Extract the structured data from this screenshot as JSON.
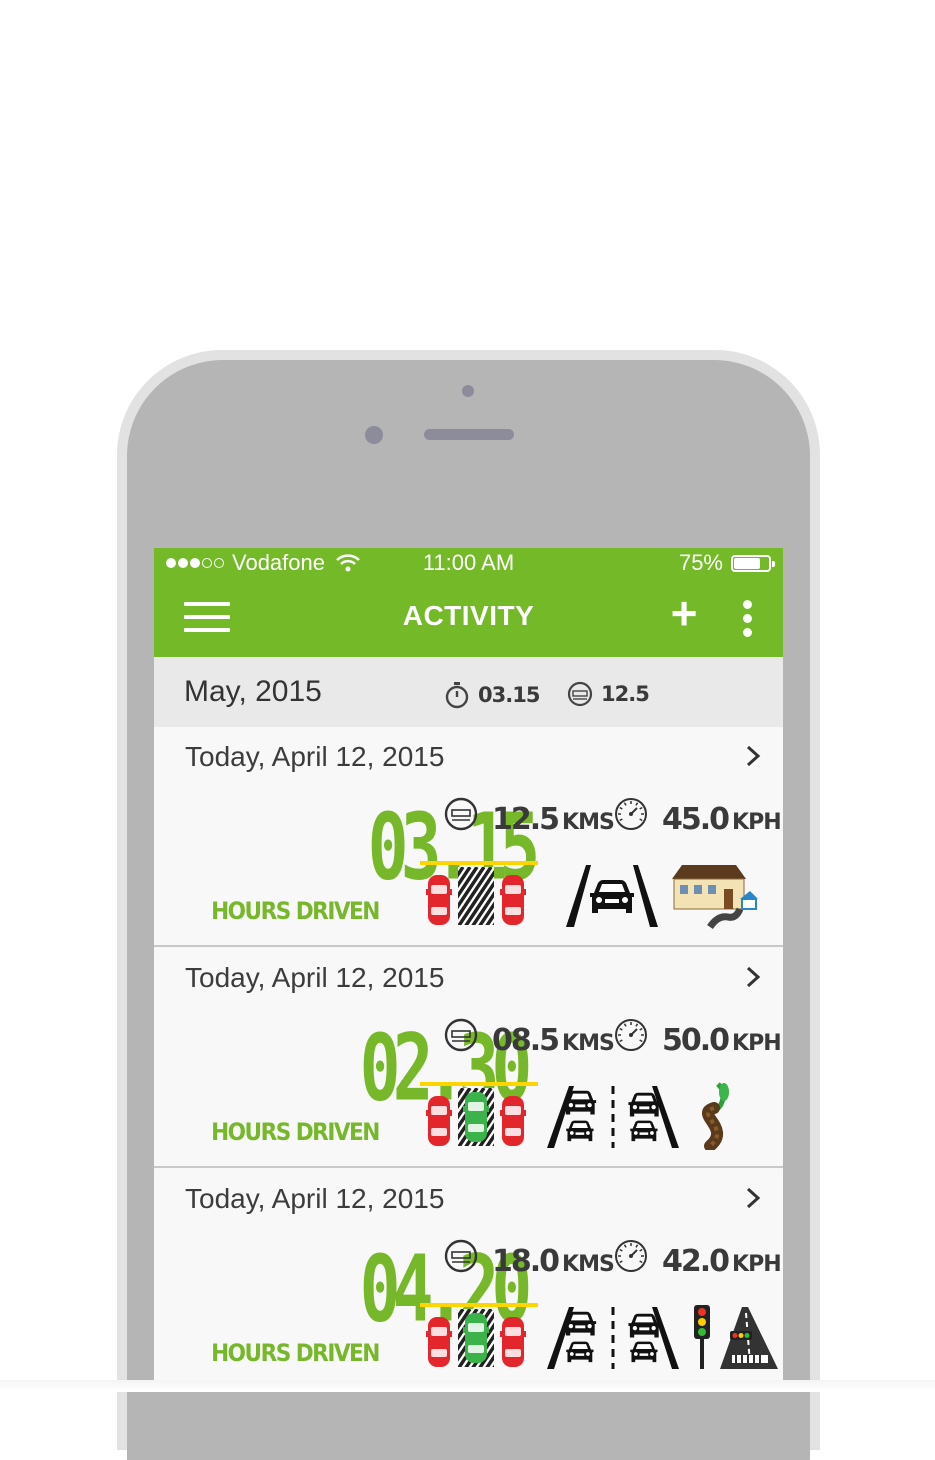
{
  "status_bar": {
    "signal": "●●●○○",
    "carrier": "Vodafone",
    "time": "11:00 AM",
    "battery": "75%",
    "battery_level": 0.75
  },
  "app_bar": {
    "title": "ACTIVITY",
    "add_label": "+"
  },
  "summary": {
    "month": "May, 2015",
    "total_hours": "03.15",
    "total_distance": "12.5"
  },
  "activities": [
    {
      "date": "Today, April 12, 2015",
      "hours": "03.15",
      "hours_label": "HOURS DRIVEN",
      "distance": "12.5",
      "distance_unit": "KMS",
      "speed": "45.0",
      "speed_unit": "KPH",
      "parking": "none",
      "lane": "single-lane-road",
      "terrain": "residential-house"
    },
    {
      "date": "Today, April 12, 2015",
      "hours": "02.30",
      "hours_label": "HOURS DRIVEN",
      "distance": "08.5",
      "distance_unit": "KMS",
      "speed": "50.0",
      "speed_unit": "KPH",
      "parking": "success",
      "lane": "two-lane-road",
      "terrain": "winding-road"
    },
    {
      "date": "Today, April 12, 2015",
      "hours": "04.20",
      "hours_label": "HOURS DRIVEN",
      "distance": "18.0",
      "distance_unit": "KMS",
      "speed": "42.0",
      "speed_unit": "KPH",
      "parking": "success",
      "lane": "two-lane-road",
      "terrain": "traffic-light-crossing"
    }
  ],
  "colors": {
    "brand_green": "#73b928",
    "stat_green": "#76b82a",
    "car_red": "#e3262b",
    "parking_line": "#ffd500"
  }
}
